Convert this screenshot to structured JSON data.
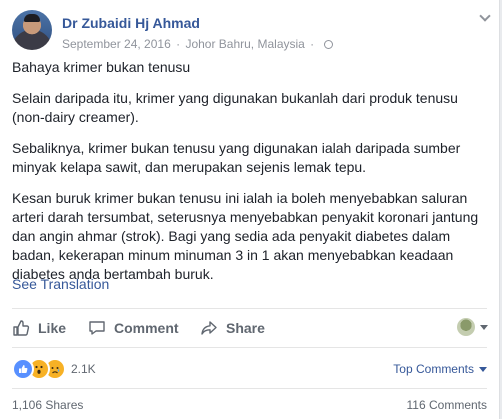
{
  "post": {
    "author": "Dr Zubaidi Hj Ahmad",
    "date": "September 24, 2016",
    "separator": "·",
    "location": "Johor Bahru, Malaysia",
    "paragraphs": [
      "Bahaya krimer bukan tenusu",
      "Selain daripada itu, krimer yang digunakan bukanlah dari produk tenusu (non-dairy creamer).",
      "Sebaliknya, krimer bukan tenusu yang digunakan ialah daripada sumber minyak kelapa sawit, dan merupakan sejenis lemak tepu.",
      "Kesan buruk krimer bukan tenusu ini ialah ia boleh menyebabkan saluran arteri darah tersumbat, seterusnya menyebabkan penyakit koronari jantung dan angin ahmar (strok). Bagi yang sedia ada penyakit diabetes dalam badan, kekerapan minum minuman 3 in 1 akan menyebabkan keadaan diabetes anda bertambah buruk."
    ],
    "see_translation": "See Translation"
  },
  "actions": {
    "like": "Like",
    "comment": "Comment",
    "share": "Share"
  },
  "reactions": {
    "count": "2.1K",
    "types": [
      "like",
      "wow",
      "sad"
    ]
  },
  "comments_sort": "Top Comments",
  "stats": {
    "shares": "1,106 Shares",
    "comments": "116 Comments"
  },
  "colors": {
    "link": "#365899",
    "text": "#1d2129",
    "meta": "#90949c",
    "like_blue": "#5890ff",
    "emoji_yellow": "#f7b125"
  },
  "icons": [
    "globe-icon",
    "chevron-down-icon",
    "thumbs-up-icon",
    "comment-icon",
    "share-icon",
    "like-reaction-icon",
    "wow-reaction-icon",
    "sad-reaction-icon"
  ]
}
